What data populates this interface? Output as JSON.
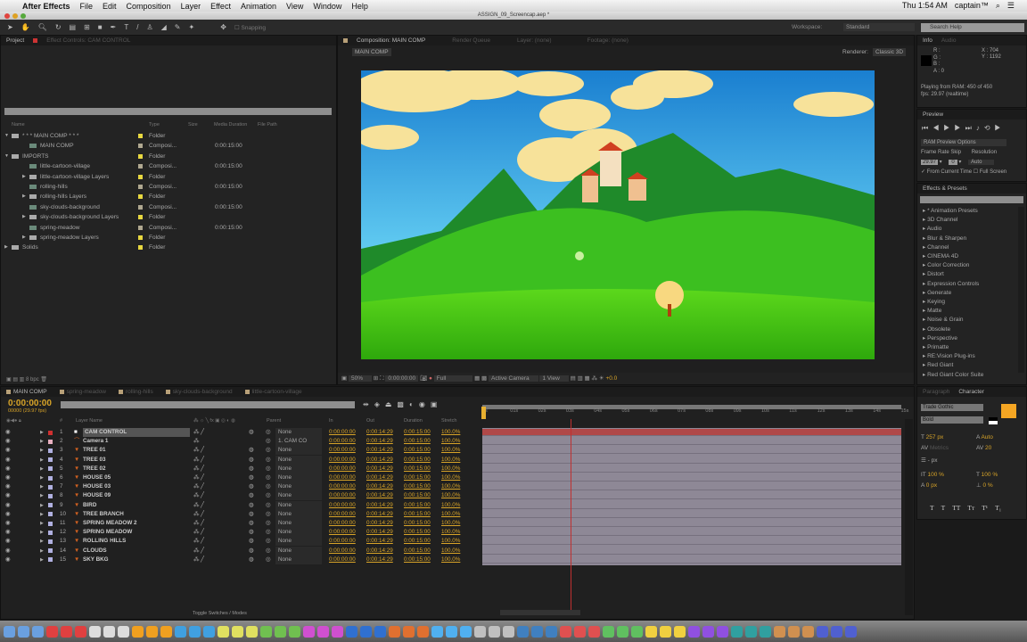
{
  "menubar": {
    "app": "After Effects",
    "items": [
      "File",
      "Edit",
      "Composition",
      "Layer",
      "Effect",
      "Animation",
      "View",
      "Window",
      "Help"
    ],
    "clock": "Thu 1:54 AM",
    "user": "captain™"
  },
  "window_title": "ASSIGN_09_Screencap.aep *",
  "toolbar": {
    "snapping": "Snapping",
    "workspace_label": "Workspace:",
    "workspace": "Standard",
    "search_help": "Search Help"
  },
  "project": {
    "tab": "Project",
    "effect_controls_tab": "Effect Controls: CAM CONTROL",
    "columns": [
      "Name",
      "Type",
      "Size",
      "Media Duration",
      "File Path"
    ],
    "items": [
      {
        "name": "* * * MAIN COMP * * *",
        "type": "Folder",
        "duration": "",
        "kind": "folder",
        "indent": 0,
        "exp": "open"
      },
      {
        "name": "MAIN COMP",
        "type": "Composi...",
        "duration": "0:00:15:00",
        "kind": "comp",
        "indent": 1,
        "exp": ""
      },
      {
        "name": "IMPORTS",
        "type": "Folder",
        "duration": "",
        "kind": "folder",
        "indent": 0,
        "exp": "open"
      },
      {
        "name": "little-cartoon-village",
        "type": "Composi...",
        "duration": "0:00:15:00",
        "kind": "comp",
        "indent": 1,
        "exp": ""
      },
      {
        "name": "little-cartoon-village Layers",
        "type": "Folder",
        "duration": "",
        "kind": "folder",
        "indent": 1,
        "exp": "closed"
      },
      {
        "name": "rolling-hills",
        "type": "Composi...",
        "duration": "0:00:15:00",
        "kind": "comp",
        "indent": 1,
        "exp": ""
      },
      {
        "name": "rolling-hills Layers",
        "type": "Folder",
        "duration": "",
        "kind": "folder",
        "indent": 1,
        "exp": "closed"
      },
      {
        "name": "sky-clouds-background",
        "type": "Composi...",
        "duration": "0:00:15:00",
        "kind": "comp",
        "indent": 1,
        "exp": ""
      },
      {
        "name": "sky-clouds-background Layers",
        "type": "Folder",
        "duration": "",
        "kind": "folder",
        "indent": 1,
        "exp": "closed"
      },
      {
        "name": "spring-meadow",
        "type": "Composi...",
        "duration": "0:00:15:00",
        "kind": "comp",
        "indent": 1,
        "exp": ""
      },
      {
        "name": "spring-meadow Layers",
        "type": "Folder",
        "duration": "",
        "kind": "folder",
        "indent": 1,
        "exp": "closed"
      },
      {
        "name": "Solids",
        "type": "Folder",
        "duration": "",
        "kind": "folder",
        "indent": 0,
        "exp": "closed"
      }
    ],
    "bpc": "8 bpc"
  },
  "composition": {
    "tab": "Composition: MAIN COMP",
    "other_tabs": [
      "Render Queue",
      "Layer: (none)",
      "Footage: (none)"
    ],
    "breadcrumb": "MAIN COMP",
    "renderer_label": "Renderer:",
    "renderer": "Classic 3D",
    "viewer": {
      "zoom": "50%",
      "timecode": "0:00:00:00",
      "resolution": "Full",
      "camera": "Active Camera",
      "views": "1 View",
      "exposure": "+0.0"
    }
  },
  "info": {
    "tab": "Info",
    "audio_tab": "Audio",
    "r": "R :",
    "g": "G :",
    "b": "B :",
    "a": "A : 0",
    "x": "X : 704",
    "y": "Y : 1192",
    "status1": "Playing from RAM: 450 of 450",
    "status2": "fps: 29.97 (realtime)"
  },
  "preview": {
    "tab": "Preview",
    "options": "RAM Preview Options",
    "frame_rate_label": "Frame Rate",
    "skip_label": "Skip",
    "resolution_label": "Resolution",
    "frame_rate": "29.97",
    "skip": "0",
    "resolution": "Auto",
    "from_current": "From Current Time",
    "full_screen": "Full Screen"
  },
  "effects": {
    "tab": "Effects & Presets",
    "items": [
      "* Animation Presets",
      "3D Channel",
      "Audio",
      "Blur & Sharpen",
      "Channel",
      "CINEMA 4D",
      "Color Correction",
      "Distort",
      "Expression Controls",
      "Generate",
      "Keying",
      "Matte",
      "Noise & Grain",
      "Obsolete",
      "Perspective",
      "Primatte",
      "RE:Vision Plug-ins",
      "Red Giant",
      "Red Giant Color Suite"
    ]
  },
  "character": {
    "tab": "Character",
    "paragraph_tab": "Paragraph",
    "font": "Trade Gothic",
    "style": "Bold",
    "size": "257 px",
    "leading": "Auto",
    "kerning": "Metrics",
    "tracking": "20",
    "stroke": "- px",
    "vscale": "100 %",
    "hscale": "100 %",
    "baseline": "0 px",
    "tsume": "0 %",
    "fill_color": "#f5a623",
    "styles": [
      "T",
      "T",
      "TT",
      "Tт",
      "T¹",
      "T₁"
    ]
  },
  "timeline": {
    "tabs": [
      "MAIN COMP",
      "spring-meadow",
      "rolling-hills",
      "sky-clouds-background",
      "little-cartoon-village"
    ],
    "timecode": "0:00:00:00",
    "frames": "00000 (29.97 fps)",
    "columns": {
      "num": "#",
      "name": "Layer Name",
      "parent": "Parent",
      "in": "In",
      "out": "Out",
      "duration": "Duration",
      "stretch": "Stretch"
    },
    "ruler": [
      "0s",
      "01s",
      "02s",
      "03s",
      "04s",
      "05s",
      "06s",
      "07s",
      "08s",
      "09s",
      "10s",
      "11s",
      "12s",
      "13s",
      "14s",
      "15s"
    ],
    "toggle_label": "Toggle Switches / Modes",
    "layers": [
      {
        "num": "1",
        "name": "CAM CONTROL",
        "label": "#d03030",
        "parent": "None"
      },
      {
        "num": "2",
        "name": "Camera 1",
        "label": "#e8b0c0",
        "parent": "1. CAM CO"
      },
      {
        "num": "3",
        "name": "TREE 01",
        "label": "#b0b0e0",
        "parent": "None"
      },
      {
        "num": "4",
        "name": "TREE 03",
        "label": "#b0b0e0",
        "parent": "None"
      },
      {
        "num": "5",
        "name": "TREE 02",
        "label": "#b0b0e0",
        "parent": "None"
      },
      {
        "num": "6",
        "name": "HOUSE 05",
        "label": "#b0b0e0",
        "parent": "None"
      },
      {
        "num": "7",
        "name": "HOUSE 03",
        "label": "#b0b0e0",
        "parent": "None"
      },
      {
        "num": "8",
        "name": "HOUSE 09",
        "label": "#b0b0e0",
        "parent": "None"
      },
      {
        "num": "9",
        "name": "BIRD",
        "label": "#b0b0e0",
        "parent": "None"
      },
      {
        "num": "10",
        "name": "TREE BRANCH",
        "label": "#b0b0e0",
        "parent": "None"
      },
      {
        "num": "11",
        "name": "SPRING MEADOW 2",
        "label": "#b0b0e0",
        "parent": "None"
      },
      {
        "num": "12",
        "name": "SPRING MEADOW",
        "label": "#b0b0e0",
        "parent": "None"
      },
      {
        "num": "13",
        "name": "ROLLING HILLS",
        "label": "#b0b0e0",
        "parent": "None"
      },
      {
        "num": "14",
        "name": "CLOUDS",
        "label": "#b0b0e0",
        "parent": "None"
      },
      {
        "num": "15",
        "name": "SKY BKG",
        "label": "#b0b0e0",
        "parent": "None"
      }
    ],
    "in": "0:00:00:00",
    "out": "0:00:14:29",
    "duration": "0:00:15:00",
    "stretch": "100.0%"
  },
  "colors": {
    "accent": "#d8a428",
    "selected_bar": "#b04848",
    "layer_bar": "#8e8896"
  }
}
